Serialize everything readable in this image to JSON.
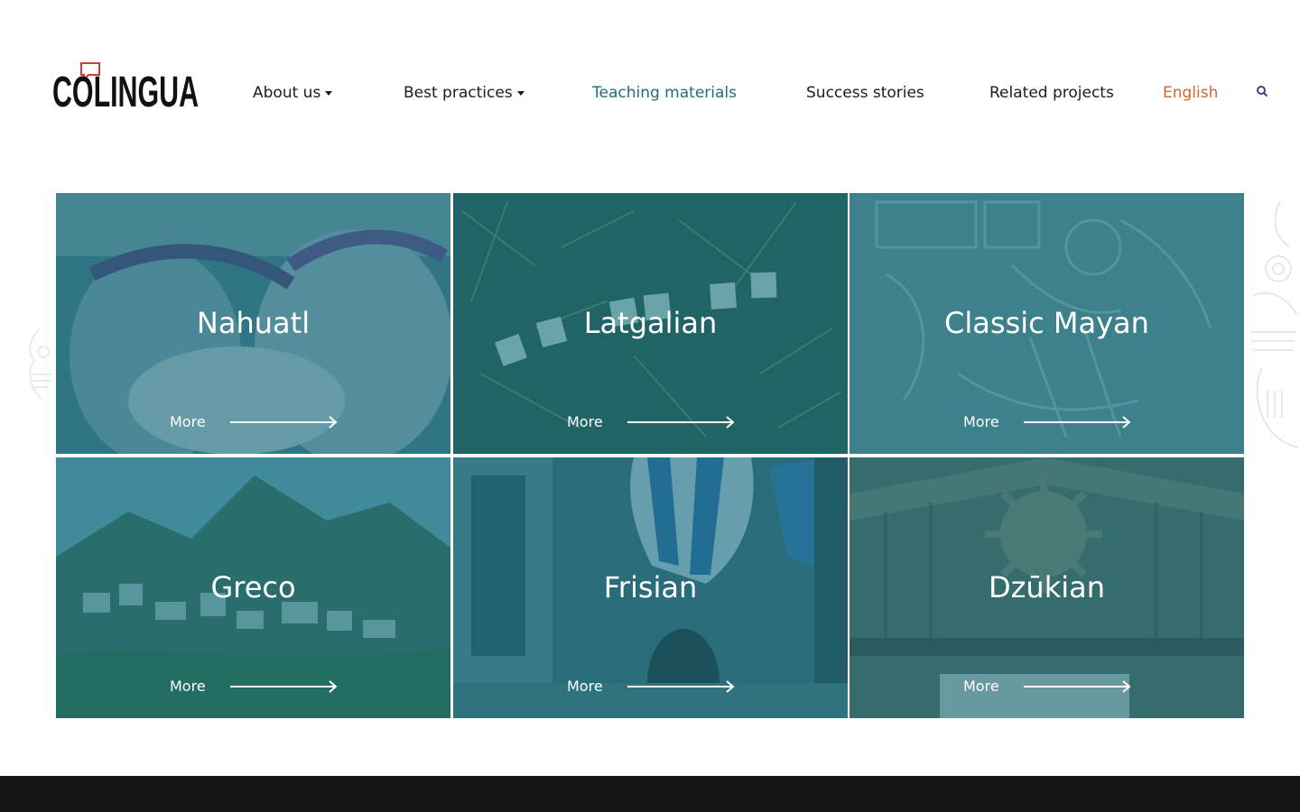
{
  "brand": {
    "logo_text": "CoLINGUA",
    "accent": "#d63a36"
  },
  "nav": {
    "items": [
      {
        "label": "About us",
        "has_dropdown": true
      },
      {
        "label": "Best practices",
        "has_dropdown": true
      },
      {
        "label": "Teaching materials",
        "active": true
      },
      {
        "label": "Success stories"
      },
      {
        "label": "Related projects"
      }
    ],
    "language": "English",
    "search_icon": "search-icon"
  },
  "colors": {
    "active_nav": "#1f6f78",
    "language": "#d2662f",
    "card_overlay": "#186e7c",
    "footer": "#151515"
  },
  "cards": [
    {
      "title": "Nahuatl",
      "more": "More"
    },
    {
      "title": "Latgalian",
      "more": "More"
    },
    {
      "title": "Classic Mayan",
      "more": "More"
    },
    {
      "title": "Greco",
      "more": "More"
    },
    {
      "title": "Frisian",
      "more": "More"
    },
    {
      "title": "Dzūkian",
      "more": "More"
    }
  ]
}
